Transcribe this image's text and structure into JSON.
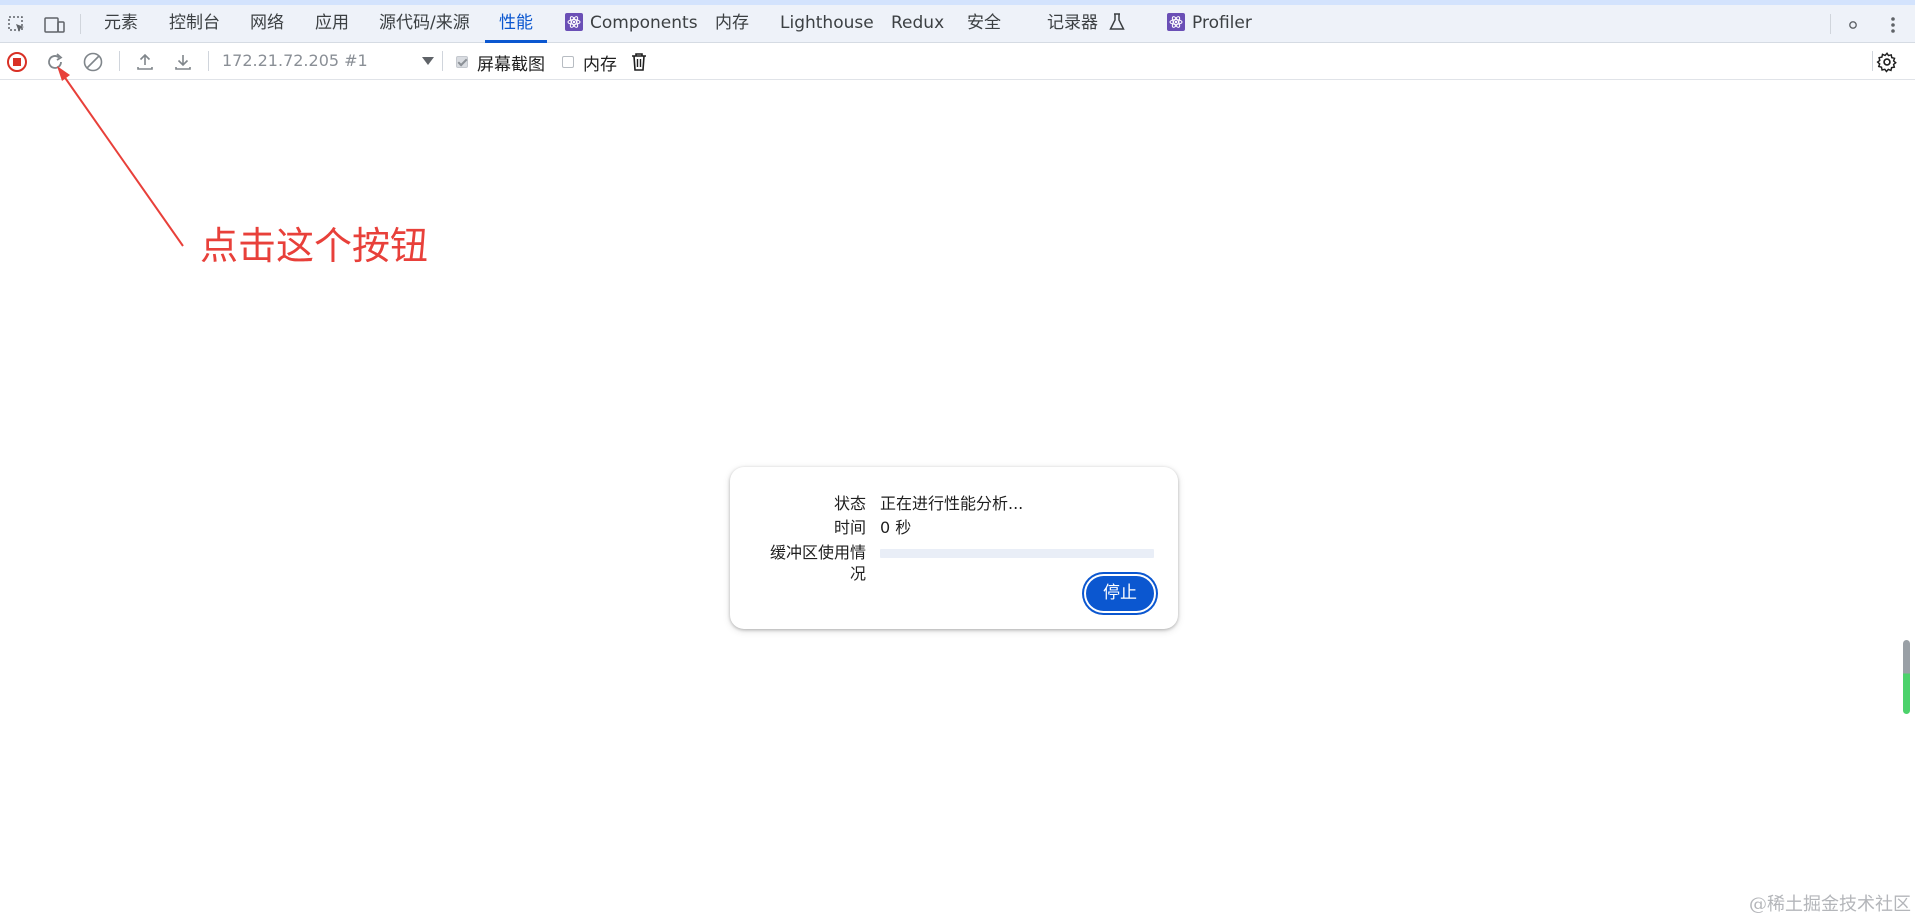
{
  "tabs": [
    {
      "label": "元素"
    },
    {
      "label": "控制台"
    },
    {
      "label": "网络"
    },
    {
      "label": "应用"
    },
    {
      "label": "源代码/来源"
    },
    {
      "label": "性能",
      "active": true
    },
    {
      "label": "Components",
      "icon": "react-icon"
    },
    {
      "label": "内存"
    },
    {
      "label": "Lighthouse"
    },
    {
      "label": "Redux"
    },
    {
      "label": "安全"
    },
    {
      "label": "记录器",
      "icon": "flask-icon"
    },
    {
      "label": "Profiler",
      "icon": "react-icon"
    }
  ],
  "toolbar": {
    "session": "172.21.72.205 #1",
    "screenshots_label": "屏幕截图",
    "screenshots_checked": true,
    "memory_label": "内存",
    "memory_checked": false
  },
  "annotation": {
    "text": "点击这个按钮",
    "color": "#e8403a"
  },
  "dialog": {
    "status_label": "状态",
    "status_value": "正在进行性能分析...",
    "time_label": "时间",
    "time_value": "0 秒",
    "buffer_label_line1": "缓冲区使用情",
    "buffer_label_line2": "况",
    "buffer_usage_fraction": 0.0,
    "stop_label": "停止"
  },
  "watermark": "@稀土掘金技术社区",
  "colors": {
    "accent": "#0b57d0",
    "record_red": "#d93025",
    "annotation": "#e8403a"
  }
}
